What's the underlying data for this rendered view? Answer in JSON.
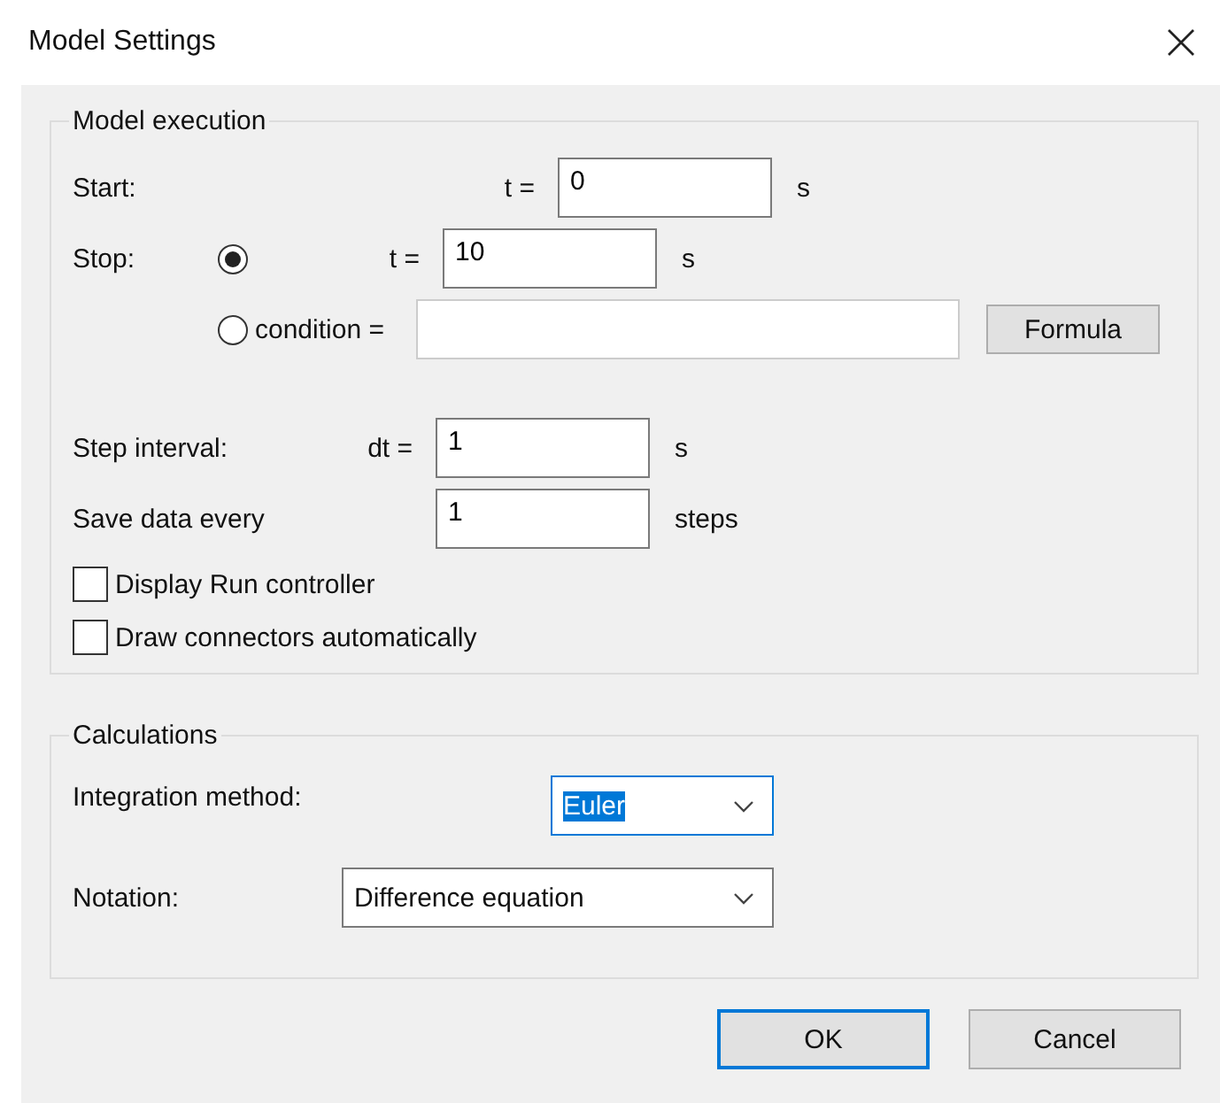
{
  "window": {
    "title": "Model Settings"
  },
  "model_execution": {
    "title": "Model execution",
    "start": {
      "label": "Start:",
      "symbol": "t =",
      "value": "0",
      "unit": "s"
    },
    "stop": {
      "label": "Stop:",
      "time": {
        "selected": true,
        "symbol": "t =",
        "value": "10",
        "unit": "s"
      },
      "condition": {
        "selected": false,
        "label": "condition =",
        "button": "Formula"
      }
    },
    "step": {
      "label": "Step interval:",
      "symbol": "dt =",
      "value": "1",
      "unit": "s"
    },
    "save": {
      "label": "Save data every",
      "value": "1",
      "unit": "steps"
    },
    "options": [
      {
        "label": "Display Run controller",
        "checked": false
      },
      {
        "label": "Draw connectors automatically",
        "checked": false
      }
    ]
  },
  "calculations": {
    "title": "Calculations",
    "fields": [
      {
        "label": "Integration method:",
        "value": "Euler",
        "focused": true
      },
      {
        "label": "Notation:",
        "value": "Difference equation",
        "focused": false
      }
    ]
  },
  "buttons": [
    {
      "label": "OK",
      "default": true
    },
    {
      "label": "Cancel",
      "default": false
    }
  ]
}
